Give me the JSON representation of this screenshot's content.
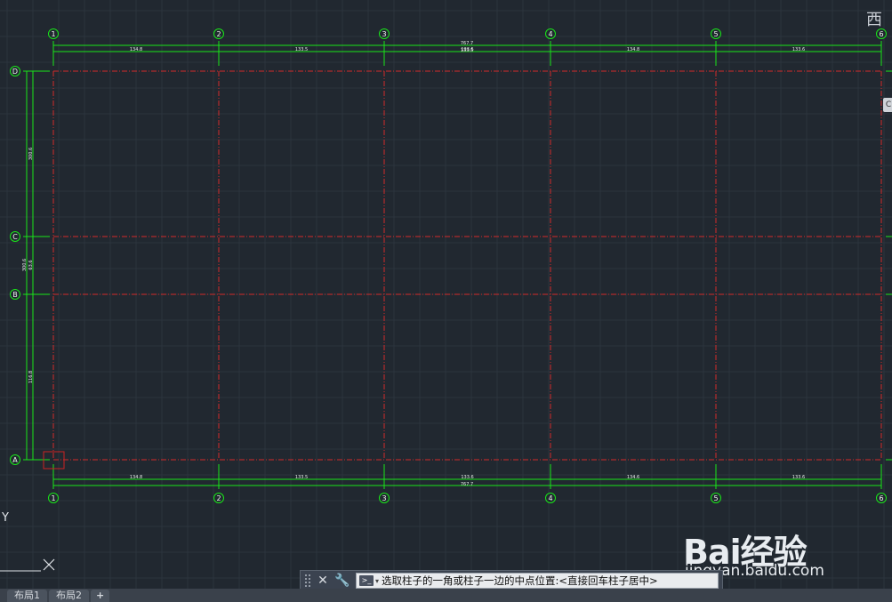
{
  "drawing": {
    "column_axes": [
      "1",
      "2",
      "3",
      "4",
      "5",
      "6"
    ],
    "row_axes": [
      "D",
      "C",
      "B",
      "A"
    ],
    "top_dims": [
      "134.8",
      "133.5",
      "133.5",
      "134.8",
      "133.6"
    ],
    "top_total_upper": "767.7",
    "top_mid_label": "133.5",
    "bottom_dims": [
      "134.8",
      "133.5",
      "133.6",
      "134.6",
      "133.6"
    ],
    "bottom_total": "767.7",
    "left_dims_outer": [
      "300.8",
      "116.8"
    ],
    "left_dims_inner": [
      "300.6",
      "63.6"
    ],
    "left_dim_top_outer": "300.6",
    "ucs_label": "Y",
    "grid_line_color": "#d42a2a",
    "dim_color": "#19e619",
    "bg_color": "#212830"
  },
  "viewcube": {
    "label": "西"
  },
  "nav_stub": {
    "label": "C"
  },
  "command_line": {
    "text": "选取柱子的一角或柱子一边的中点位置:<直接回车柱子居中>"
  },
  "tabs": [
    {
      "label": "布局1"
    },
    {
      "label": "布局2"
    },
    {
      "label": "+"
    }
  ],
  "watermark": {
    "logo": "Bai经验",
    "url": "jingyan.baidu.com"
  }
}
